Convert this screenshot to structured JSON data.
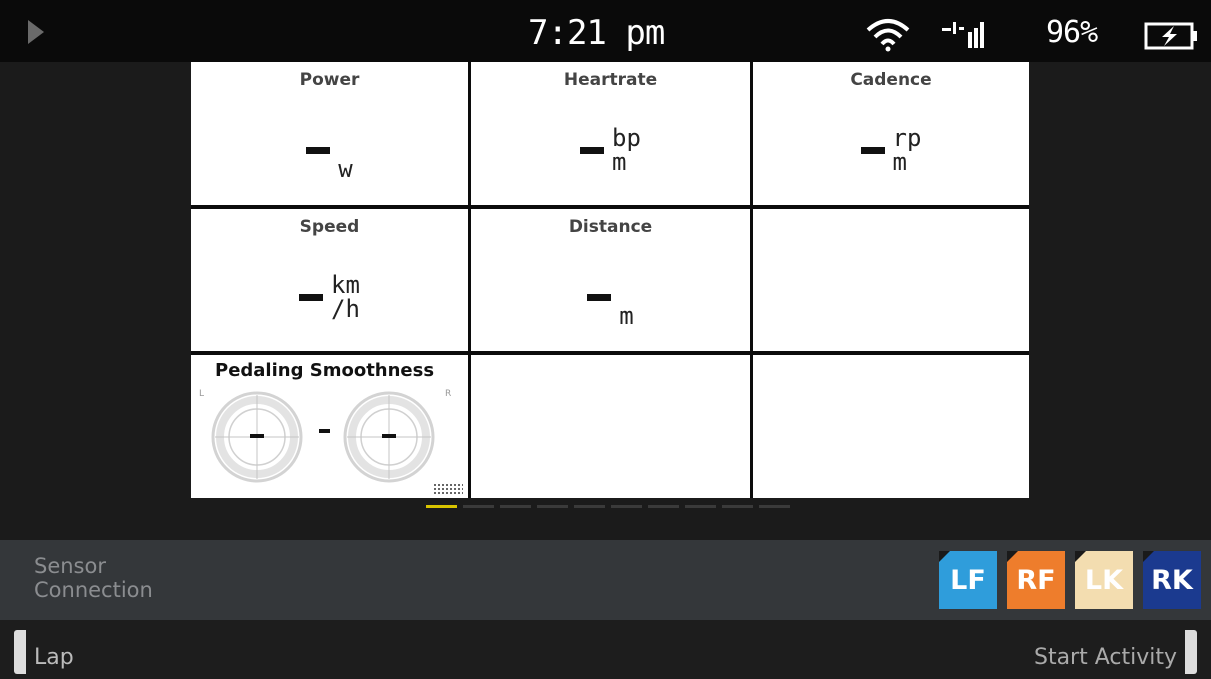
{
  "status_bar": {
    "play_icon": "play-icon",
    "time": "7:21 pm",
    "wifi_icon": "wifi-icon",
    "signal_icon": "signal-icon",
    "battery_percent": "96%",
    "battery_icon": "battery-charging-icon"
  },
  "fields": {
    "power": {
      "label": "Power",
      "value": "-",
      "unit": "w"
    },
    "heartrate": {
      "label": "Heartrate",
      "value": "-",
      "unit_top": "bp",
      "unit_bottom": "m"
    },
    "cadence": {
      "label": "Cadence",
      "value": "-",
      "unit_top": "rp",
      "unit_bottom": "m"
    },
    "speed": {
      "label": "Speed",
      "value": "-",
      "unit_top": "km",
      "unit_bottom": "/h"
    },
    "distance": {
      "label": "Distance",
      "value": "-",
      "unit": "m"
    },
    "pedaling": {
      "label": "Pedaling Smoothness",
      "left_side": "L",
      "right_side": "R",
      "left_value": "-",
      "right_value": "-"
    }
  },
  "pager": {
    "pages": 10,
    "active": 0
  },
  "sensor_connection": {
    "label_line1": "Sensor",
    "label_line2": "Connection",
    "badges": [
      {
        "label": "LF",
        "color": "#2f9ddb"
      },
      {
        "label": "RF",
        "color": "#ee7d2c"
      },
      {
        "label": "LK",
        "color": "#f3ddb0"
      },
      {
        "label": "RK",
        "color": "#1b3a8f"
      }
    ]
  },
  "footer": {
    "left_label": "Lap",
    "right_label": "Start Activity"
  },
  "colors": {
    "page_indicator_active": "#d9c400"
  }
}
